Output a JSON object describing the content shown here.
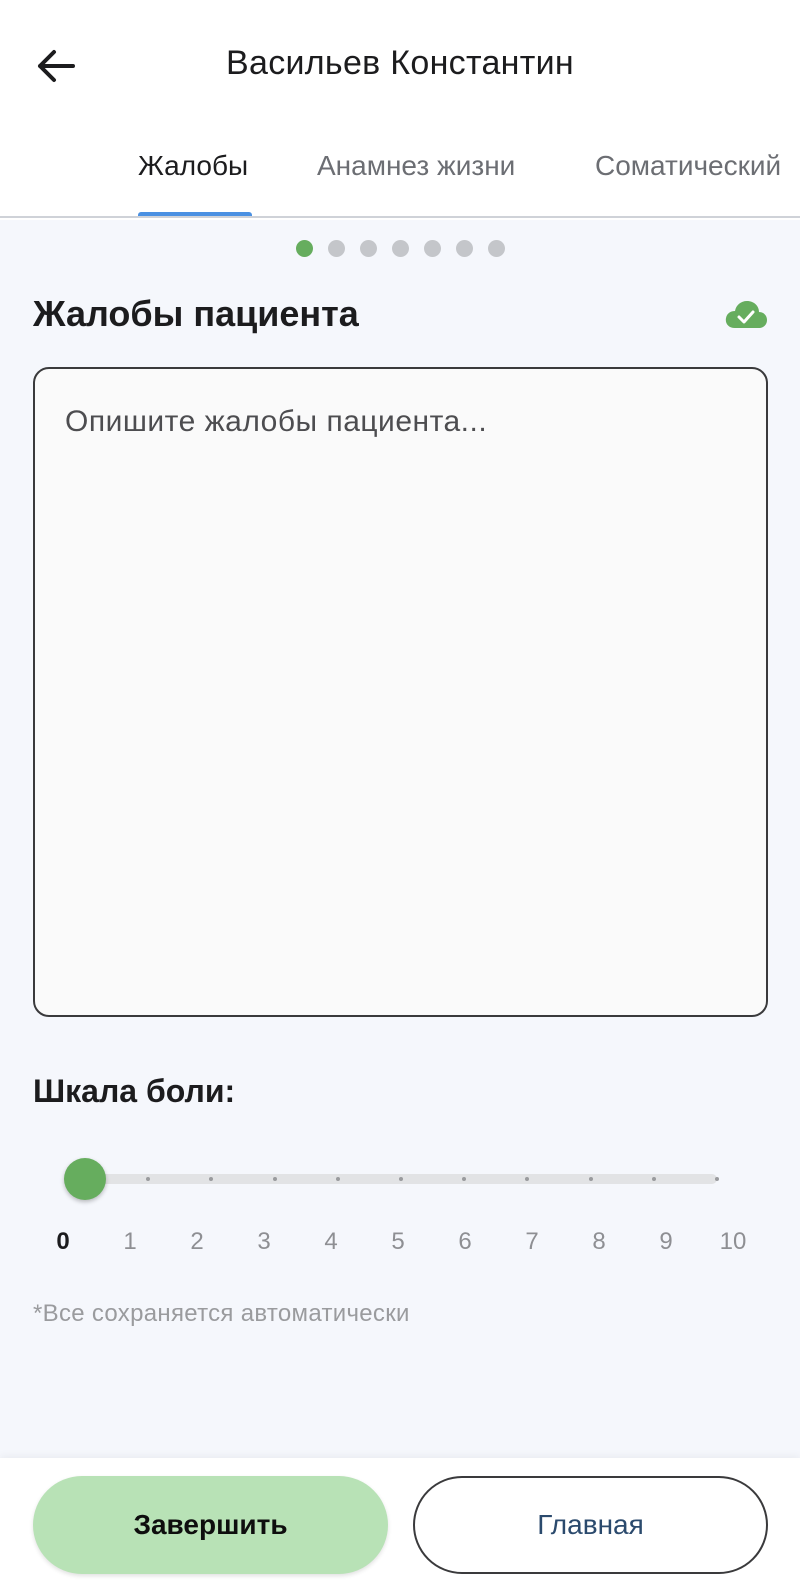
{
  "header": {
    "title": "Васильев Константин",
    "back_icon": "arrow-left-icon"
  },
  "tabs": [
    {
      "label": "Жалобы",
      "active": true
    },
    {
      "label": "Анамнез жизни",
      "active": false
    },
    {
      "label": "Соматический",
      "active": false
    }
  ],
  "pager": {
    "total": 7,
    "current": 1
  },
  "section": {
    "title": "Жалобы пациента",
    "saved_icon": "cloud-check-icon",
    "saved_color": "#66ad5e"
  },
  "complaints": {
    "value": "",
    "placeholder": "Опишите жалобы пациента..."
  },
  "pain_scale": {
    "label": "Шкала боли:",
    "min": 0,
    "max": 10,
    "value": 0,
    "ticks": [
      "0",
      "1",
      "2",
      "3",
      "4",
      "5",
      "6",
      "7",
      "8",
      "9",
      "10"
    ]
  },
  "autosave_note": "*Все сохраняется автоматически",
  "actions": {
    "finish_label": "Завершить",
    "home_label": "Главная"
  },
  "colors": {
    "accent_green": "#66ad5e",
    "finish_button": "#b8e2b6",
    "tab_indicator": "#4a90e2"
  }
}
